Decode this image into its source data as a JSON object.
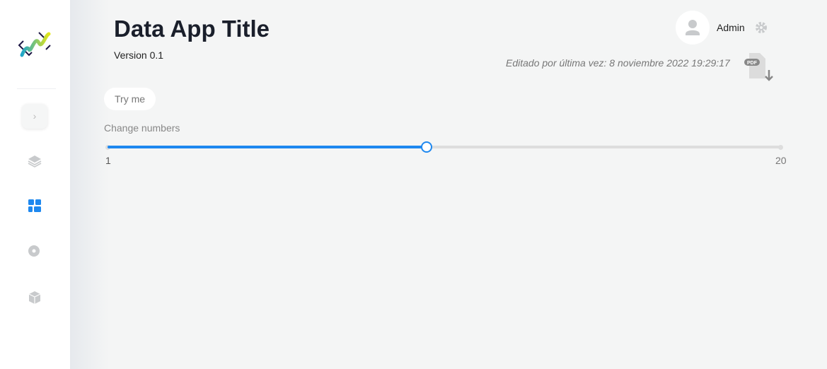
{
  "sidebar": {
    "items": [
      {
        "icon": "layers-icon"
      },
      {
        "icon": "dashboard-icon",
        "active": true
      },
      {
        "icon": "palette-settings-icon"
      },
      {
        "icon": "cube-icon"
      }
    ],
    "accent": "#1e88ef"
  },
  "header": {
    "title": "Data App Title",
    "version": "Version 0.1",
    "user": "Admin",
    "edited": "Editado por última vez: 8 noviembre 2022 19:29:17",
    "pdf_badge": "PDF"
  },
  "main": {
    "try_button": "Try me",
    "slider": {
      "label": "Change numbers",
      "min": 1,
      "max": 20,
      "value": 10,
      "min_label": "1",
      "max_label": "20"
    }
  }
}
